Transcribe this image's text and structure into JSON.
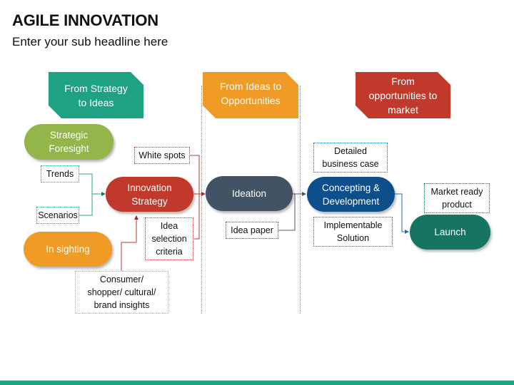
{
  "title": "AGILE INNOVATION",
  "subtitle": "Enter your sub headline here",
  "colors": {
    "teal": "#1fa183",
    "orange": "#f09b25",
    "red": "#c0392b",
    "green": "#93b54a",
    "slate": "#435366",
    "blue": "#0d4f8b",
    "dark_teal": "#167560"
  },
  "phases": [
    {
      "label": "From Strategy to Ideas",
      "line1": "From Strategy",
      "line2": "to Ideas"
    },
    {
      "label": "From Ideas to Opportunities",
      "line1": "From Ideas to",
      "line2": "Opportunities"
    },
    {
      "label": "From opportunities to market",
      "line1": "From",
      "line2": "opportunities to",
      "line3": "market"
    }
  ],
  "nodes": {
    "strategic_foresight": {
      "line1": "Strategic",
      "line2": "Foresight"
    },
    "in_sighting": "In sighting",
    "innovation_strategy": {
      "line1": "Innovation",
      "line2": "Strategy"
    },
    "ideation": "Ideation",
    "concepting": {
      "line1": "Concepting &",
      "line2": "Development"
    },
    "launch": "Launch"
  },
  "inputs": {
    "trends": "Trends",
    "scenarios": "Scenarios",
    "white_spots": "White spots",
    "idea_selection": {
      "line1": "Idea",
      "line2": "selection",
      "line3": "criteria"
    },
    "consumer": {
      "line1": "Consumer/",
      "line2": "shopper/ cultural/",
      "line3": "brand insights"
    },
    "idea_paper": "Idea paper",
    "business_case": {
      "line1": "Detailed",
      "line2": "business case"
    },
    "implementable": {
      "line1": "Implementable",
      "line2": "Solution"
    },
    "market_ready": {
      "line1": "Market ready",
      "line2": "product"
    }
  }
}
